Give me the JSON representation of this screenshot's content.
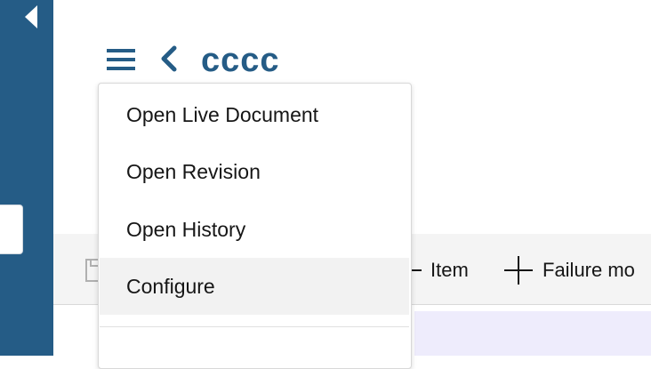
{
  "header": {
    "title": "cccc",
    "accent_color": "#255c86"
  },
  "left_rail": {
    "color": "#255c86",
    "toggle_icon": "caret-left-icon"
  },
  "menu": {
    "items": [
      {
        "label": "Open Live Document"
      },
      {
        "label": "Open Revision"
      },
      {
        "label": "Open History"
      },
      {
        "label": "Configure",
        "highlighted": true
      }
    ]
  },
  "toolbar": {
    "item_label": "Item",
    "failure_label": "Failure mo"
  }
}
